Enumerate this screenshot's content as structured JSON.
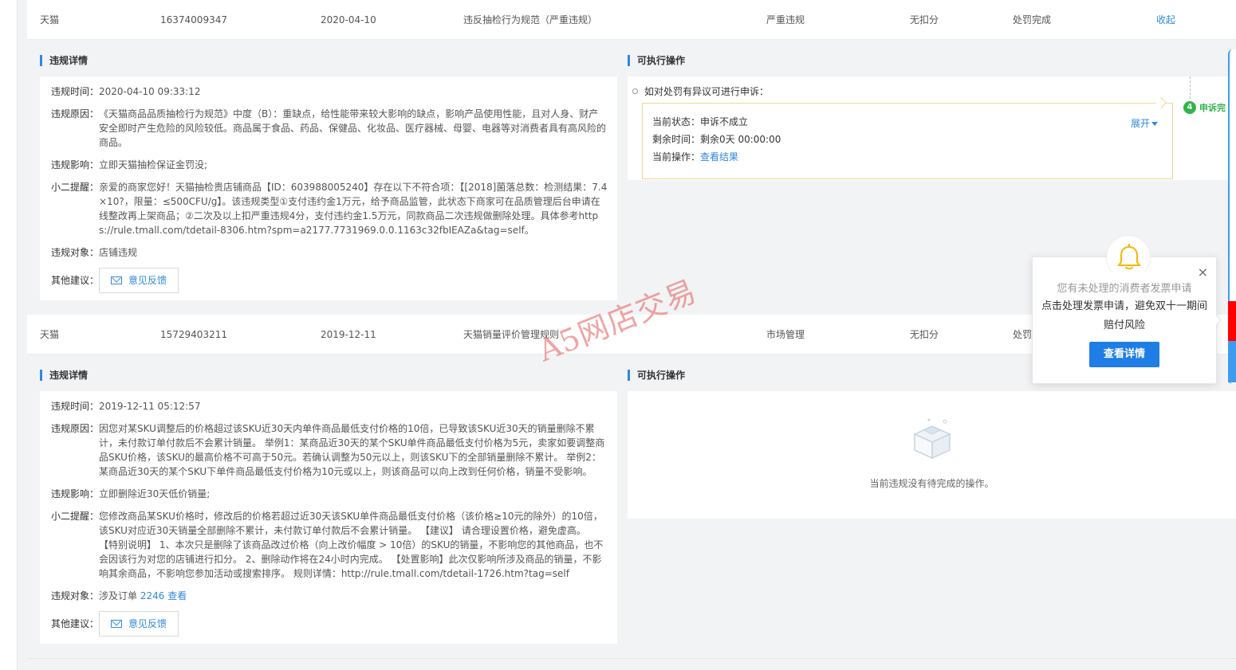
{
  "rows": [
    {
      "platform": "天猫",
      "id": "16374009347",
      "date": "2020-04-10",
      "rule": "违反抽检行为规范（严重违规）",
      "category": "严重违规",
      "deduction": "无扣分",
      "status": "处罚完成",
      "toggle": "收起",
      "detail_title": "违规详情",
      "detail": {
        "time_label": "违规时间：",
        "time": "2020-04-10 09:33:12",
        "reason_label": "违规原因：",
        "reason": "《天猫商品品质抽检行为规范》中度（B）：重缺点，给性能带来较大影响的缺点，影响产品使用性能，且对人身、财产安全即时产生危险的风险较低。商品属于食品、药品、保健品、化妆品、医疗器械、母婴、电器等对消费者具有高风险的商品。",
        "impact_label": "违规影响：",
        "impact": "立即天猫抽检保证金罚没;",
        "tip_label": "小二提醒：",
        "tip": "亲爱的商家您好！天猫抽检贵店铺商品【ID：603988005240】存在以下不符合项：【[2018]菌落总数：检测结果：7.4×10?，限量：≤500CFU/g】。该违规类型①支付违约金1万元，给予商品监管，此状态下商家可在品质管理后台申请在线整改再上架商品；②二次及以上扣严重违规4分，支付违约金1.5万元，同款商品二次违规做删除处理。具体参考https://rule.tmall.com/tdetail-8306.htm?spm=a2177.7731969.0.0.1163c32fbIEAZa&tag=self。",
        "object_label": "违规对象：",
        "object": "店铺违规",
        "suggest_label": "其他建议：",
        "feedback": "意见反馈"
      },
      "action_title": "可执行操作",
      "action": {
        "appeal_hint": "如对处罚有异议可进行申诉：",
        "state_label": "当前状态：",
        "state": "申诉不成立",
        "remain_label": "剩余时间：",
        "remain": "剩余0天 00:00:00",
        "op_label": "当前操作：",
        "op": "查看结果",
        "expand": "展开",
        "step_no": "4",
        "step_text": "申诉完"
      }
    },
    {
      "platform": "天猫",
      "id": "15729403211",
      "date": "2019-12-11",
      "rule": "天猫销量评价管理规则",
      "category": "市场管理",
      "deduction": "无扣分",
      "status": "处罚",
      "detail_title": "违规详情",
      "detail": {
        "time_label": "违规时间：",
        "time": "2019-12-11 05:12:57",
        "reason_label": "违规原因：",
        "reason": "因您对某SKU调整后的价格超过该SKU近30天内单件商品最低支付价格的10倍，已导致该SKU近30天的销量删除不累计，未付款订单付款后不会累计销量。 举例1：某商品近30天的某个SKU单件商品最低支付价格为5元，卖家如要调整商品SKU价格，该SKU的最高价格不可高于50元。若确认调整为50元以上，则该SKU下的全部销量删除不累计。 举例2：某商品近30天的某个SKU下单件商品最低支付价格为10元或以上，则该商品可以向上改到任何价格，销量不受影响。",
        "impact_label": "违规影响：",
        "impact": "立即删除近30天低价销量;",
        "tip_label": "小二提醒：",
        "tip": "您修改商品某SKU价格时，修改后的价格若超过近30天该SKU单件商品最低支付价格（该价格≥10元的除外）的10倍，该SKU对应近30天销量全部删除不累计，未付款订单付款后不会累计销量。 【建议】 请合理设置价格，避免虚高。 【特别说明】 1、本次只是删除了该商品改过价格（向上改价幅度 > 10倍）的SKU的销量，不影响您的其他商品，也不会因该行为对您的店铺进行扣分。 2、删除动作将在24小时内完成。 【处置影响】此次仅影响所涉及商品的销量，不影响其余商品，不影响您参加活动或搜索排序。 规则详情：http://rule.tmall.com/tdetail-1726.htm?tag=self",
        "object_label": "违规对象：",
        "object": "涉及订单",
        "object_count": "2246",
        "object_link": "查看",
        "suggest_label": "其他建议：",
        "feedback": "意见反馈"
      },
      "action_title": "可执行操作",
      "action": {
        "empty_text": "当前违规没有待完成的操作。"
      }
    }
  ],
  "popup": {
    "line1": "您有未处理的消费者发票申请",
    "line2": "点击处理发票申请，避免双十一期间赔付风险",
    "button": "查看详情",
    "close": "×"
  },
  "watermark": "A5网店交易",
  "colors": {
    "accent": "#3089dc",
    "success": "#31b44b",
    "popup_button": "#1e7ee6",
    "rail_red": "#ff0000"
  },
  "icons": [
    "mail-icon",
    "bell-icon",
    "close-icon",
    "caret-down-icon",
    "empty-box-icon"
  ]
}
